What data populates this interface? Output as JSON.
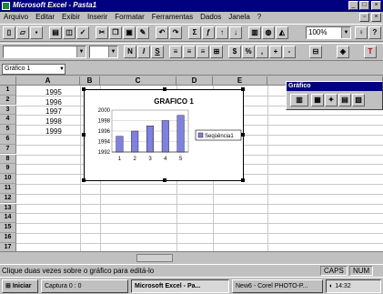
{
  "window": {
    "title": "Microsoft Excel - Pasta1"
  },
  "menu": [
    "Arquivo",
    "Editar",
    "Exibir",
    "Inserir",
    "Formatar",
    "Ferramentas",
    "Dados",
    "Janela",
    "?"
  ],
  "toolbar": {
    "zoom": "100%"
  },
  "formula_bar": {
    "name_box": "Gráfico 1"
  },
  "columns": [
    "A",
    "B",
    "C",
    "D",
    "E"
  ],
  "rows": [
    "1",
    "2",
    "3",
    "4",
    "5",
    "6",
    "7",
    "8",
    "9",
    "10",
    "11",
    "12",
    "13",
    "14",
    "15",
    "16",
    "17"
  ],
  "cells": {
    "A1": "1995",
    "A2": "1996",
    "A3": "1997",
    "A4": "1998",
    "A5": "1999"
  },
  "floating_toolbar": {
    "title": "Gráfico"
  },
  "chart_data": {
    "type": "bar",
    "title": "GRAFICO 1",
    "categories": [
      "1",
      "2",
      "3",
      "4",
      "5"
    ],
    "series": [
      {
        "name": "Seqüência1",
        "values": [
          1995,
          1996,
          1997,
          1998,
          1999
        ]
      }
    ],
    "ylim": [
      1992,
      2000
    ],
    "yticks": [
      "2000",
      "1998",
      "1996",
      "1994",
      "1992"
    ],
    "legend": "right",
    "colors": {
      "bar": "#8080e0"
    }
  },
  "status": {
    "message": "Clique duas vezes sobre o gráfico para editá-lo",
    "caps": "CAPS",
    "num": "NUM"
  },
  "taskbar": {
    "start": "Iniciar",
    "tasks": [
      "Captura 0 : 0",
      "Microsoft Excel - Pa...",
      "New6 - Corel PHOTO-P..."
    ],
    "clock": "14:32"
  }
}
